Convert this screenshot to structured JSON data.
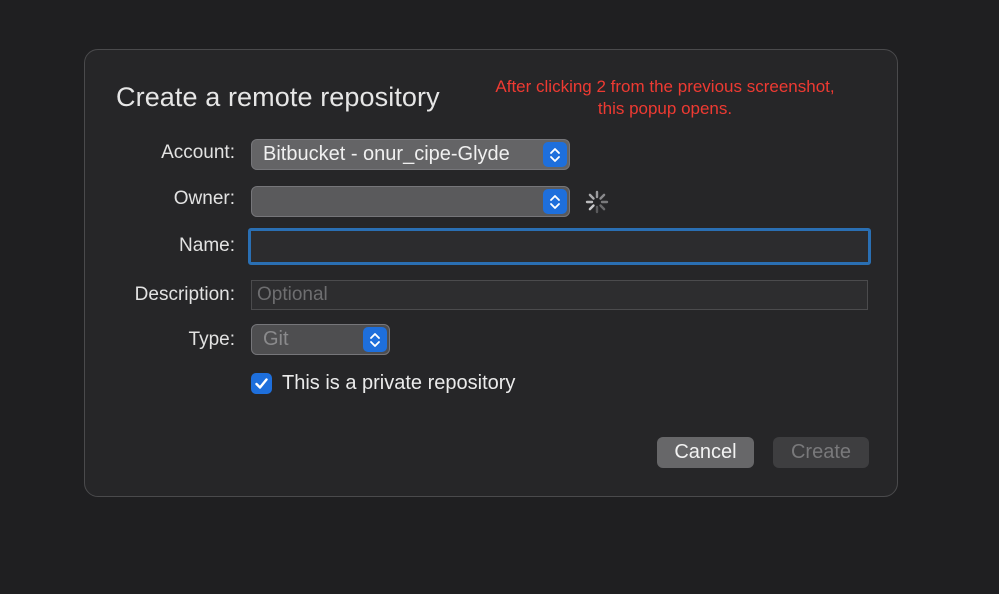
{
  "dialog": {
    "title": "Create a remote repository",
    "annotation": "After clicking 2 from the previous screenshot, this popup opens.",
    "account": {
      "label": "Account:",
      "value": "Bitbucket - onur_cipe-Glyde"
    },
    "owner": {
      "label": "Owner:",
      "value": ""
    },
    "name": {
      "label": "Name:",
      "value": ""
    },
    "description": {
      "label": "Description:",
      "placeholder": "Optional"
    },
    "type": {
      "label": "Type:",
      "value": "Git"
    },
    "private": {
      "label": "This is a private repository",
      "checked": true
    },
    "buttons": {
      "cancel": "Cancel",
      "create": "Create"
    }
  },
  "colors": {
    "accent": "#1e6fdc",
    "annotation": "#ee3a32",
    "focus_ring": "#2a6fb3"
  },
  "icons": {
    "stepper": "up-down-chevron-icon",
    "spinner": "loading-spinner-icon",
    "check": "checkmark-icon"
  }
}
